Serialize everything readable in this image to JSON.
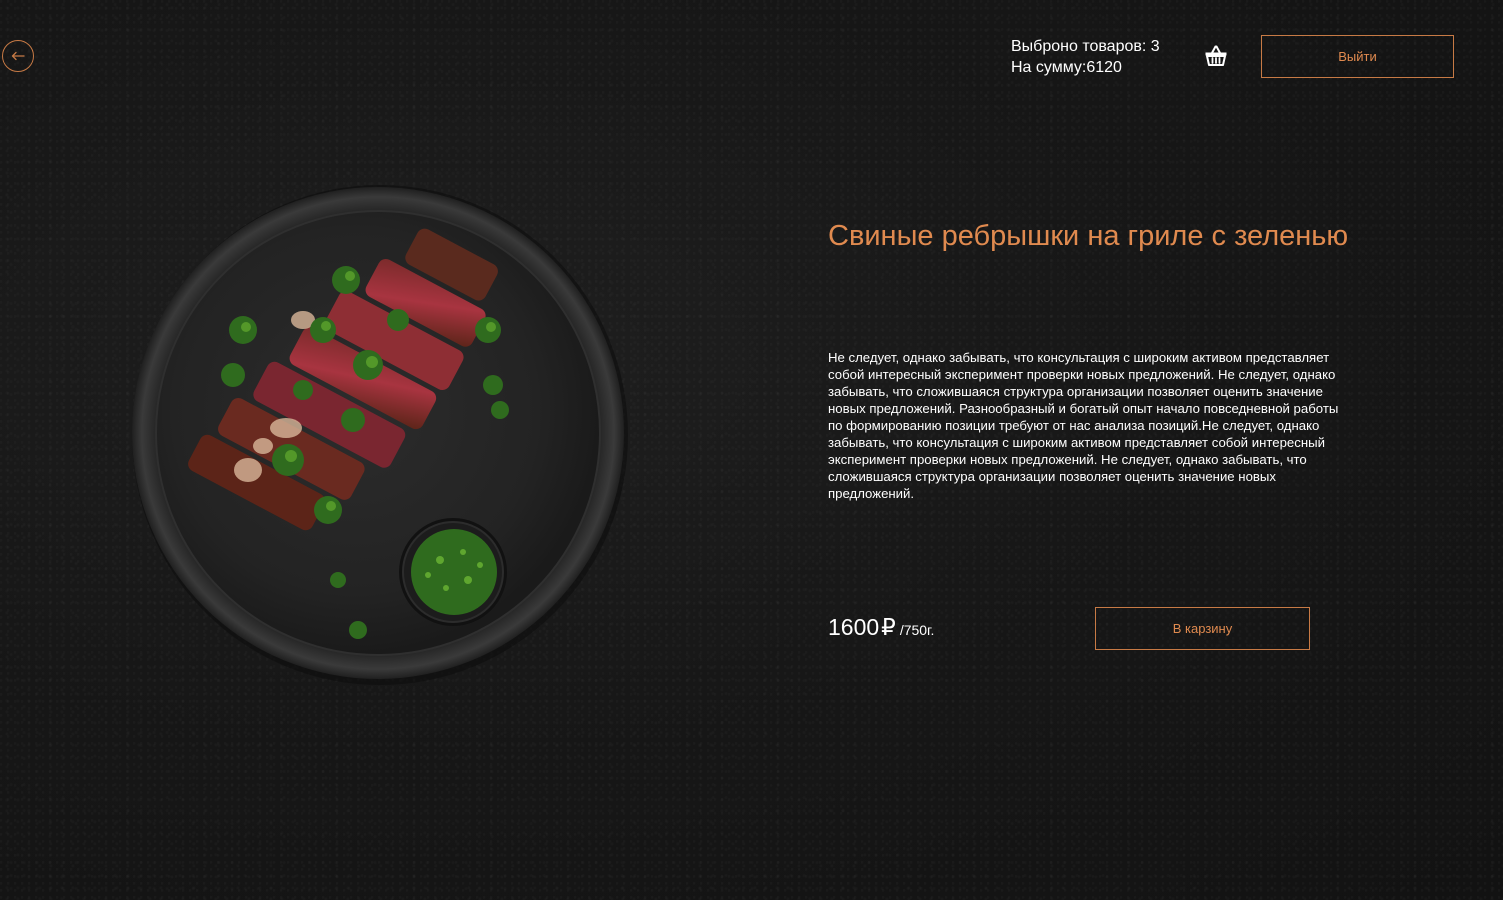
{
  "header": {
    "items_selected": "Выброно товаров: 3",
    "sum": "На сумму:6120",
    "logout_label": "Выйти"
  },
  "product": {
    "title": "Свиные ребрышки на гриле с зеленью",
    "description": "Не следует, однако забывать, что консультация с широким активом представляет собой интересный эксперимент проверки новых предложений. Не следует, однако забывать, что сложившаяся структура организации позволяет оценить значение новых предложений. Разнообразный и богатый опыт начало повседневной работы по формированию позиции требуют от нас анализа позиций.Не следует, однако забывать, что консультация с широким активом представляет собой интересный эксперимент проверки новых предложений. Не следует, однако забывать, что сложившаяся структура организации позволяет оценить значение новых предложений.",
    "price": "1600",
    "currency": "₽",
    "weight": "/750г.",
    "add_to_cart_label": "В карзину"
  },
  "colors": {
    "accent": "#e08a4f",
    "background": "#161616",
    "text": "#ffffff"
  },
  "icons": {
    "back": "arrow-left-icon",
    "cart": "basket-icon"
  }
}
